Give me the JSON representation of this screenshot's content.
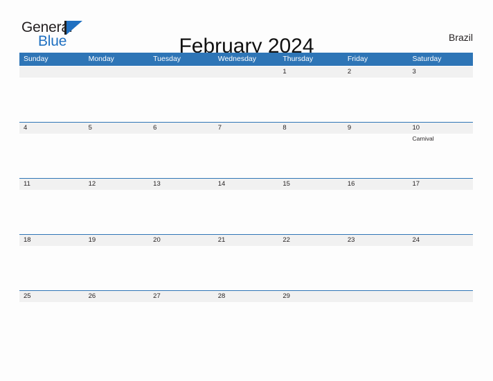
{
  "header": {
    "logo": {
      "word_one": "General",
      "word_two": "Blue",
      "mark": "triangle-flag-mark"
    },
    "title": "February 2024",
    "country": "Brazil"
  },
  "colors": {
    "header_blue": "#2e75b6",
    "logo_blue": "#1f70c1",
    "band_gray": "#f1f1f1",
    "page_background": "#fdfdfd",
    "text": "#231f20"
  },
  "calendar": {
    "weekdays": [
      "Sunday",
      "Monday",
      "Tuesday",
      "Wednesday",
      "Thursday",
      "Friday",
      "Saturday"
    ],
    "weeks": [
      {
        "days": [
          {
            "number": "",
            "events": []
          },
          {
            "number": "",
            "events": []
          },
          {
            "number": "",
            "events": []
          },
          {
            "number": "",
            "events": []
          },
          {
            "number": "1",
            "events": []
          },
          {
            "number": "2",
            "events": []
          },
          {
            "number": "3",
            "events": []
          }
        ]
      },
      {
        "days": [
          {
            "number": "4",
            "events": []
          },
          {
            "number": "5",
            "events": []
          },
          {
            "number": "6",
            "events": []
          },
          {
            "number": "7",
            "events": []
          },
          {
            "number": "8",
            "events": []
          },
          {
            "number": "9",
            "events": []
          },
          {
            "number": "10",
            "events": [
              "Carnival"
            ]
          }
        ]
      },
      {
        "days": [
          {
            "number": "11",
            "events": []
          },
          {
            "number": "12",
            "events": []
          },
          {
            "number": "13",
            "events": []
          },
          {
            "number": "14",
            "events": []
          },
          {
            "number": "15",
            "events": []
          },
          {
            "number": "16",
            "events": []
          },
          {
            "number": "17",
            "events": []
          }
        ]
      },
      {
        "days": [
          {
            "number": "18",
            "events": []
          },
          {
            "number": "19",
            "events": []
          },
          {
            "number": "20",
            "events": []
          },
          {
            "number": "21",
            "events": []
          },
          {
            "number": "22",
            "events": []
          },
          {
            "number": "23",
            "events": []
          },
          {
            "number": "24",
            "events": []
          }
        ]
      },
      {
        "days": [
          {
            "number": "25",
            "events": []
          },
          {
            "number": "26",
            "events": []
          },
          {
            "number": "27",
            "events": []
          },
          {
            "number": "28",
            "events": []
          },
          {
            "number": "29",
            "events": []
          },
          {
            "number": "",
            "events": []
          },
          {
            "number": "",
            "events": []
          }
        ]
      }
    ]
  }
}
